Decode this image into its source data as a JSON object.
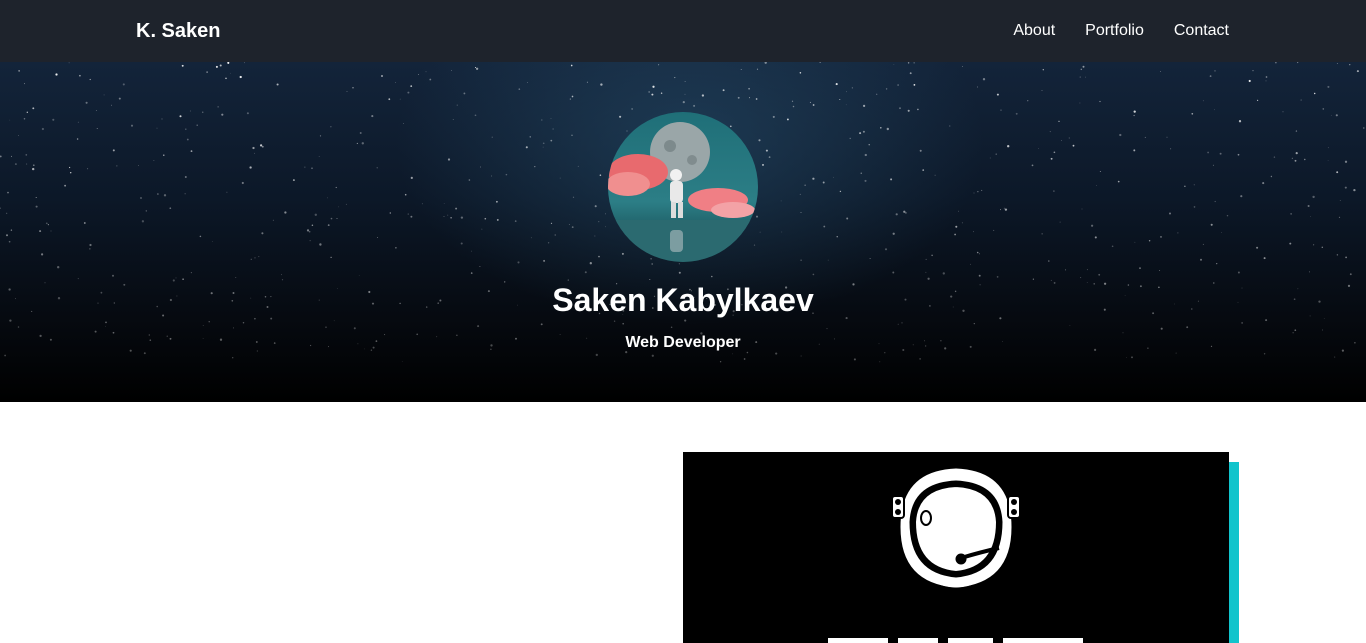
{
  "navbar": {
    "brand": "K. Saken",
    "links": [
      {
        "label": "About"
      },
      {
        "label": "Portfolio"
      },
      {
        "label": "Contact"
      }
    ]
  },
  "hero": {
    "name": "Saken Kabylkaev",
    "role": "Web Developer",
    "avatar_icon": "astronaut-moon-avatar"
  },
  "promo": {
    "icon": "astronaut-helmet-icon"
  },
  "colors": {
    "navbar_bg": "#1e232c",
    "accent": "#11c4cc",
    "promo_bg": "#000000"
  }
}
